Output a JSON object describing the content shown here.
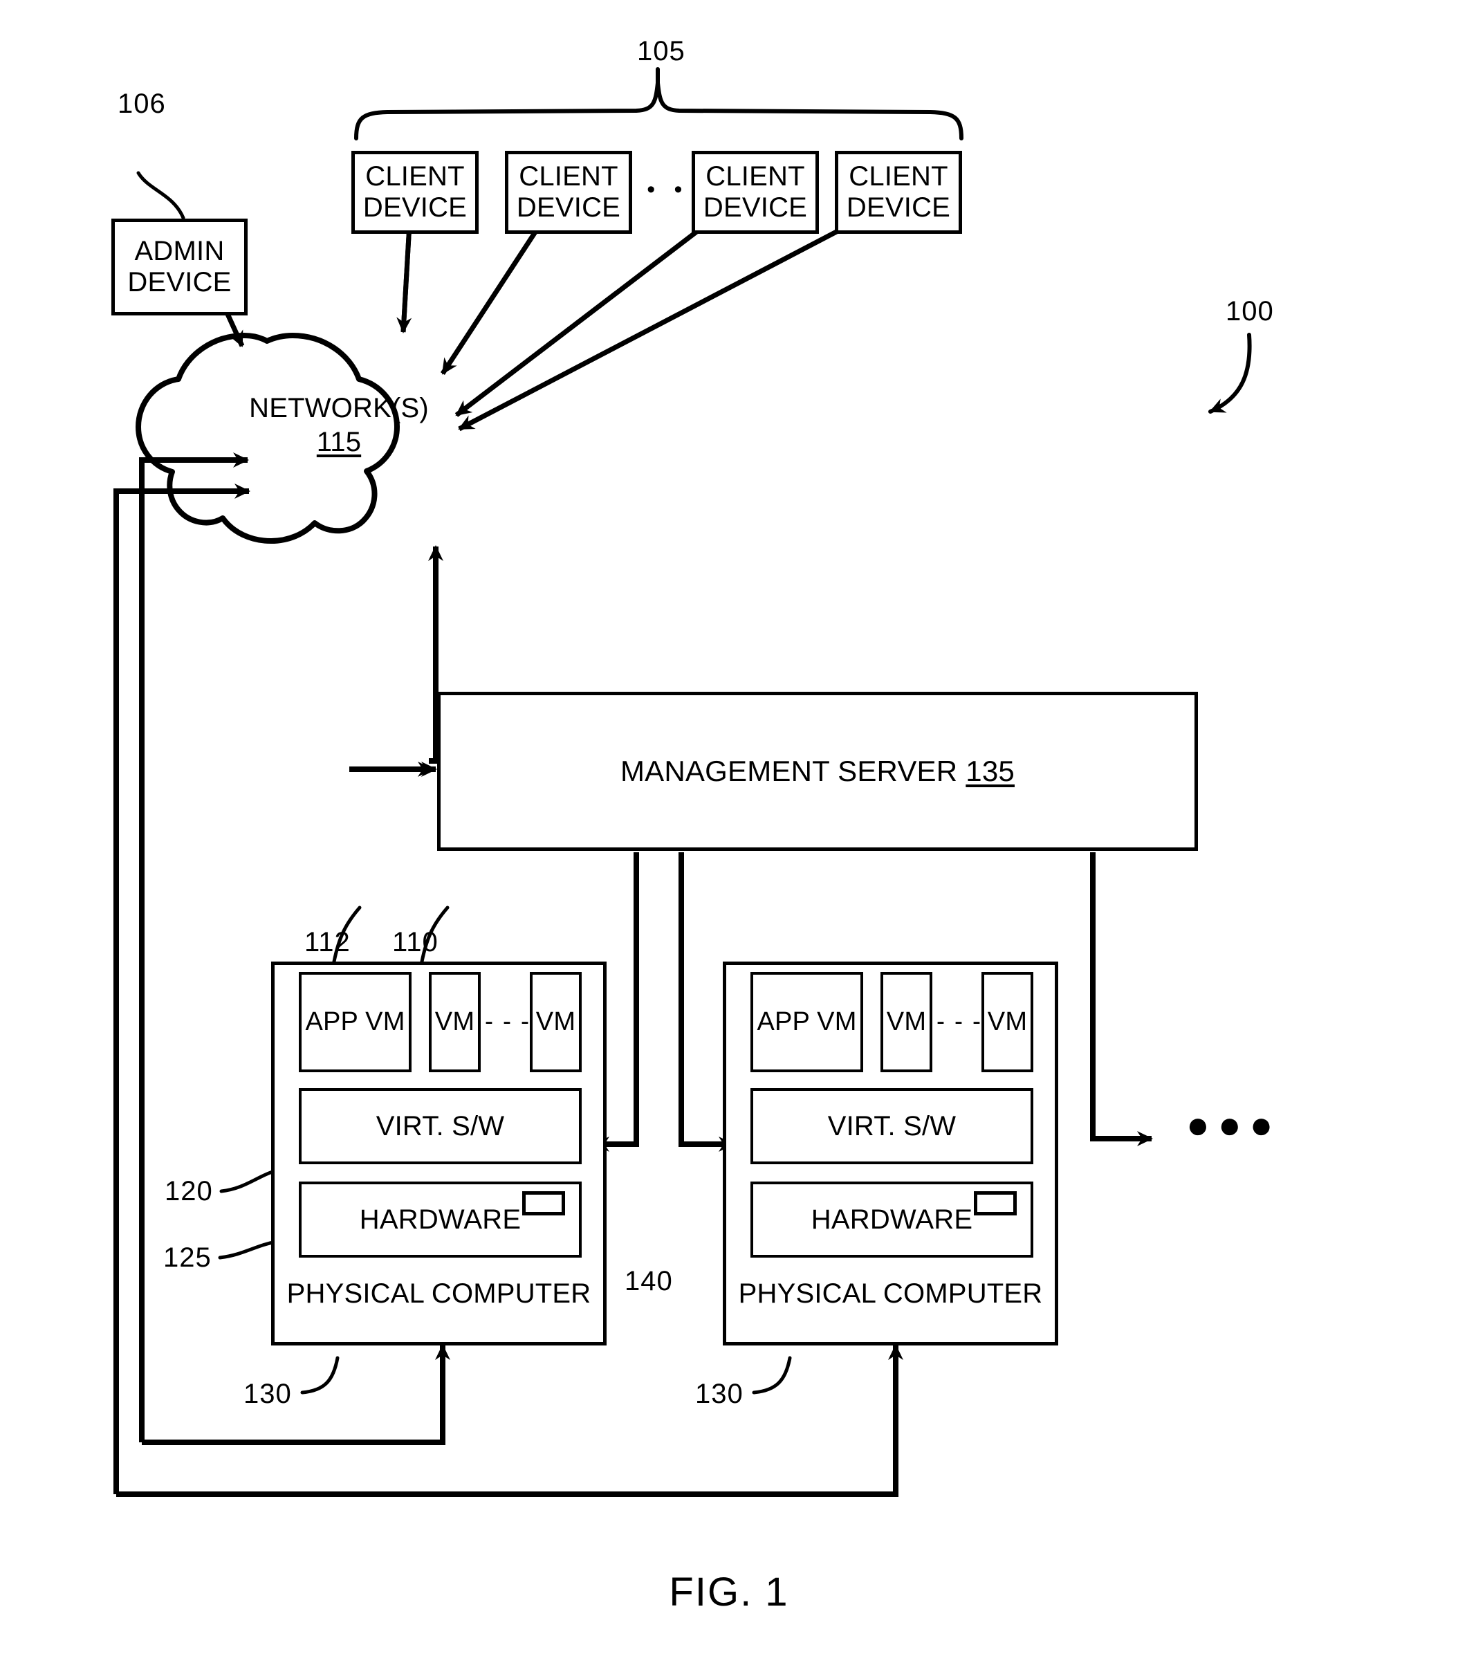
{
  "figure": {
    "caption": "FIG. 1",
    "system_ref": "100"
  },
  "client_group": {
    "ref": "105",
    "devices": [
      {
        "line1": "CLIENT",
        "line2": "DEVICE"
      },
      {
        "line1": "CLIENT",
        "line2": "DEVICE"
      },
      {
        "line1": "CLIENT",
        "line2": "DEVICE"
      },
      {
        "line1": "CLIENT",
        "line2": "DEVICE"
      }
    ],
    "ellipsis": "• • •"
  },
  "admin": {
    "ref": "106",
    "line1": "ADMIN",
    "line2": "DEVICE"
  },
  "network": {
    "label": "NETWORK(S)",
    "ref": "115"
  },
  "management_server": {
    "label": "MANAGEMENT SERVER",
    "ref": "135"
  },
  "physical_computers": [
    {
      "title": "PHYSICAL COMPUTER",
      "ref": "130",
      "app_vm": {
        "label": "APP VM",
        "ref": "112"
      },
      "vm_first": {
        "label": "VM",
        "ref": "110"
      },
      "vm_last": {
        "label": "VM"
      },
      "vm_ellipsis": "- - -",
      "virt_sw": {
        "label": "VIRT. S/W",
        "ref": "120"
      },
      "hardware": {
        "label": "HARDWARE",
        "ref": "125"
      },
      "nic": {
        "ref": "140"
      }
    },
    {
      "title": "PHYSICAL COMPUTER",
      "ref": "130",
      "app_vm": {
        "label": "APP VM"
      },
      "vm_first": {
        "label": "VM"
      },
      "vm_last": {
        "label": "VM"
      },
      "vm_ellipsis": "- - -",
      "virt_sw": {
        "label": "VIRT. S/W"
      },
      "hardware": {
        "label": "HARDWARE"
      },
      "nic": {}
    }
  ],
  "more_indicator": "●●●",
  "colors": {
    "stroke": "#000000",
    "background": "#ffffff"
  }
}
